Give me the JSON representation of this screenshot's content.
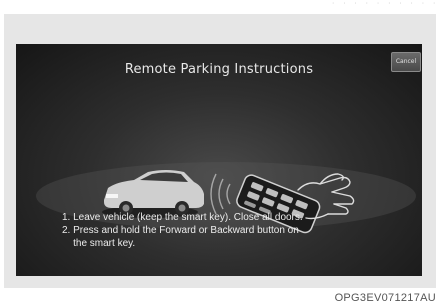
{
  "screen": {
    "title": "Remote Parking Instructions",
    "cancel_label": "Cancel",
    "instructions": [
      "1. Leave vehicle (keep the smart key). Close all doors.",
      "2. Press and hold the Forward or Backward button on",
      "    the smart key."
    ]
  },
  "illustration": {
    "icons": [
      "car-icon",
      "signal-waves-icon",
      "smart-key-icon",
      "hand-icon"
    ]
  },
  "caption": "OPG3EV071217AU"
}
